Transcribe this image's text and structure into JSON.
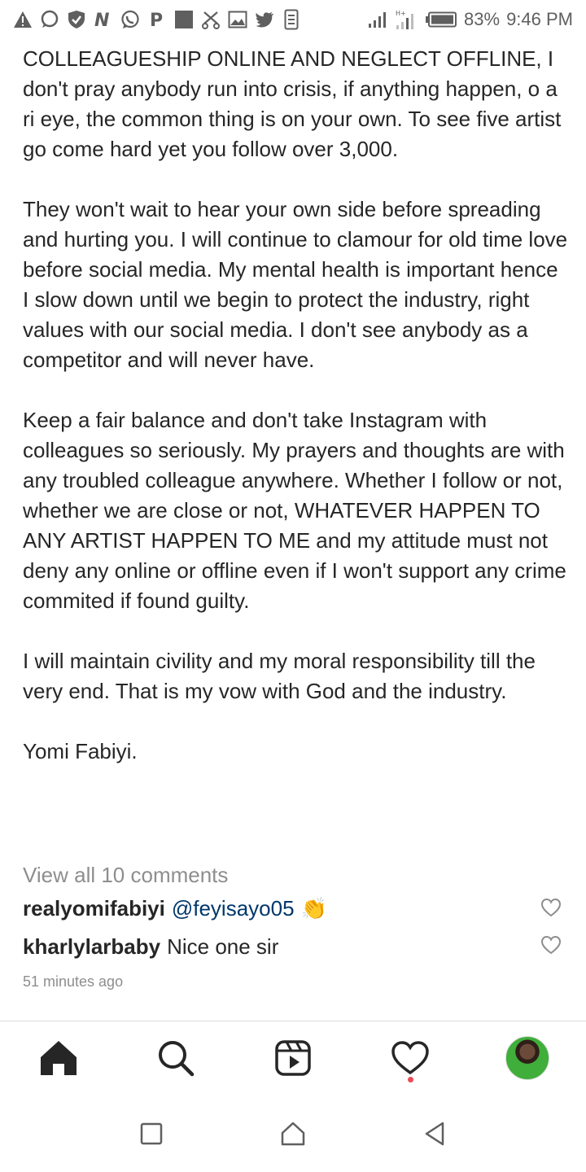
{
  "status_bar": {
    "battery": "83%",
    "time": "9:46 PM",
    "network_label": "H+",
    "left_icons": [
      "alert-icon",
      "message-icon",
      "shield-icon",
      "n-icon",
      "whatsapp-icon",
      "p-icon",
      "square-icon",
      "scissors-icon",
      "image-icon",
      "twitter-icon",
      "phone-icon"
    ]
  },
  "post": {
    "caption_paragraphs": [
      "COLLEAGUESHIP ONLINE AND NEGLECT OFFLINE, I don't pray anybody run into crisis, if anything happen, o a ri eye, the common thing is on your own. To see five artist go come hard yet you follow over 3,000.",
      "They won't wait to hear your own side before spreading and hurting you. I will continue to clamour for old time love before social media. My mental health is important hence I slow down until we begin to protect the industry, right values with our social media. I don't see anybody as a competitor and will never have.",
      "Keep a fair balance and don't take Instagram with colleagues so seriously. My prayers and thoughts are with any troubled colleague anywhere. Whether I follow or not, whether we are close or not, WHATEVER HAPPEN TO ANY ARTIST HAPPEN TO ME and my attitude must not deny any online or offline even if I won't support any crime commited if found guilty.",
      "I will maintain civility and my moral responsibility till the very end. That is my vow with God and the industry.",
      "Yomi Fabiyi."
    ],
    "view_all_comments": "View all 10 comments",
    "comments": [
      {
        "user": "realyomifabiyi",
        "mention": "@feyisayo05",
        "emoji": "👏",
        "text": ""
      },
      {
        "user": "kharlylarbaby",
        "mention": "",
        "emoji": "",
        "text": "Nice one sir"
      }
    ],
    "time_ago": "51 minutes ago"
  },
  "tab_bar": {
    "items": [
      "home-icon",
      "search-icon",
      "reels-icon",
      "activity-heart-icon",
      "profile-avatar"
    ]
  },
  "system_nav": {
    "items": [
      "recents-button",
      "home-button",
      "back-button"
    ]
  },
  "colors": {
    "text": "#262626",
    "muted": "#8e8e8e",
    "mention": "#00376b",
    "notification_dot": "#ed4956"
  }
}
